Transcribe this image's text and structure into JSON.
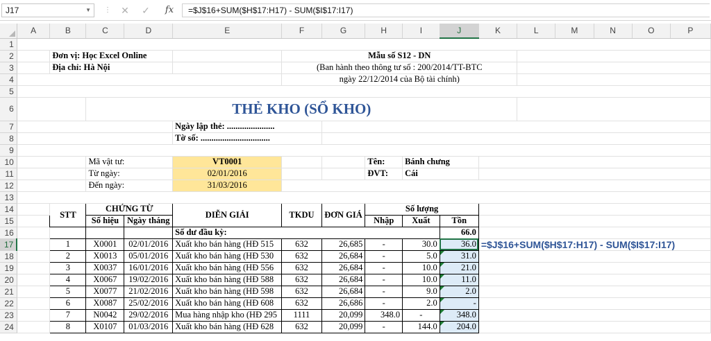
{
  "formula_bar": {
    "name_box": "J17",
    "formula": "=$J$16+SUM($H$17:H17) - SUM($I$17:I17)",
    "fx_label": "fx",
    "cancel_icon": "close-icon",
    "enter_icon": "check-icon"
  },
  "columns": [
    "A",
    "B",
    "C",
    "D",
    "E",
    "F",
    "G",
    "H",
    "I",
    "J",
    "K",
    "L",
    "M",
    "N",
    "O",
    "P"
  ],
  "selected_column": "J",
  "rows": [
    "1",
    "2",
    "3",
    "4",
    "5",
    "6",
    "7",
    "8",
    "9",
    "10",
    "11",
    "12",
    "13",
    "14",
    "15",
    "16",
    "17",
    "18",
    "19",
    "20",
    "21",
    "22",
    "23",
    "24"
  ],
  "selected_row": "17",
  "header": {
    "unit": "Đơn vị: Học Excel Online",
    "address": "Địa chỉ: Hà Nội",
    "form_no": "Mẫu số S12 - DN",
    "issued_by": "(Ban hành theo thông tư số : 200/2014/TT-BTC",
    "issued_date": "ngày 22/12/2014 của Bộ tài chính)",
    "title": "THẺ KHO (SỔ KHO)",
    "created_date": "Ngày lập thẻ: ......................",
    "sheet_no": "Tờ số: ................................"
  },
  "info": {
    "item_code_label": "Mã vật tư:",
    "item_code": "VT0001",
    "from_label": "Từ ngày:",
    "from_date": "02/01/2016",
    "to_label": "Đến ngày:",
    "to_date": "31/03/2016",
    "name_label": "Tên:",
    "name": "Bánh chưng",
    "unit_label": "ĐVT:",
    "unit": "Cái"
  },
  "table": {
    "h_stt": "STT",
    "h_voucher": "CHỨNG TỪ",
    "h_voucher_no": "Số hiệu",
    "h_voucher_date": "Ngày tháng",
    "h_desc": "DIỄN GIẢI",
    "h_account": "TKDU",
    "h_price": "ĐƠN GIÁ",
    "h_quantity": "Số lượng",
    "h_in": "Nhập",
    "h_out": "Xuất",
    "h_stock": "Tồn",
    "opening_label": "Số dư đầu kỳ:",
    "opening_value": "66.0",
    "rows": [
      {
        "stt": "1",
        "no": "X0001",
        "date": "02/01/2016",
        "desc": "Xuất kho bán hàng (HĐ 515",
        "acc": "632",
        "price": "26,685",
        "in": "-",
        "out": "30.0",
        "stock": "36.0"
      },
      {
        "stt": "2",
        "no": "X0013",
        "date": "05/01/2016",
        "desc": "Xuất kho bán hàng (HĐ 530",
        "acc": "632",
        "price": "26,684",
        "in": "-",
        "out": "5.0",
        "stock": "31.0"
      },
      {
        "stt": "3",
        "no": "X0037",
        "date": "16/01/2016",
        "desc": "Xuất kho bán hàng (HĐ 556",
        "acc": "632",
        "price": "26,684",
        "in": "-",
        "out": "10.0",
        "stock": "21.0"
      },
      {
        "stt": "4",
        "no": "X0067",
        "date": "19/02/2016",
        "desc": "Xuất kho bán hàng (HĐ 588",
        "acc": "632",
        "price": "26,684",
        "in": "-",
        "out": "10.0",
        "stock": "11.0"
      },
      {
        "stt": "5",
        "no": "X0077",
        "date": "21/02/2016",
        "desc": "Xuất kho bán hàng (HĐ 598",
        "acc": "632",
        "price": "26,684",
        "in": "-",
        "out": "9.0",
        "stock": "2.0"
      },
      {
        "stt": "6",
        "no": "X0087",
        "date": "25/02/2016",
        "desc": "Xuất kho bán hàng (HĐ 608",
        "acc": "632",
        "price": "26,686",
        "in": "-",
        "out": "2.0",
        "stock": "-"
      },
      {
        "stt": "7",
        "no": "N0042",
        "date": "29/02/2016",
        "desc": "Mua hàng nhập kho (HĐ 295",
        "acc": "1111",
        "price": "20,099",
        "in": "348.0",
        "out": "-",
        "stock": "348.0"
      },
      {
        "stt": "8",
        "no": "X0107",
        "date": "01/03/2016",
        "desc": "Xuất kho bán hàng (HĐ 628",
        "acc": "632",
        "price": "20,099",
        "in": "-",
        "out": "144.0",
        "stock": "204.0"
      }
    ]
  },
  "annotation": "=$J$16+SUM($H$17:H17) - SUM($I$17:I17)",
  "colors": {
    "accent": "#217346",
    "title": "#2f5597",
    "highlight_yellow": "#ffe699",
    "highlight_blue": "#ddebf7"
  }
}
